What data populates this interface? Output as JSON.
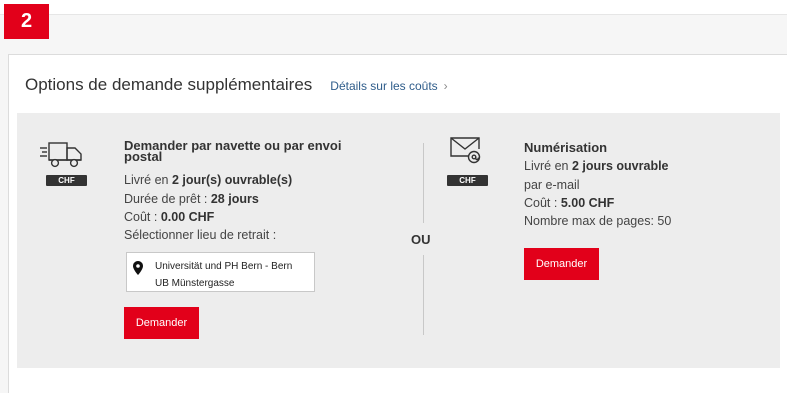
{
  "step": {
    "number": "2"
  },
  "header": {
    "title": "Options de demande supplémentaires",
    "cost_link": "Détails sur les coûts"
  },
  "separator": "OU",
  "option_shuttle": {
    "icon": "truck-icon",
    "badge": "CHF",
    "title_line1": "Demander par navette ou par envoi",
    "title_line2": "postal",
    "delivery_prefix": "Livré en ",
    "delivery_value": "2 jour(s) ouvrable(s)",
    "loan_label": "Durée de prêt : ",
    "loan_value": "28 jours",
    "cost_label": "Coût : ",
    "cost_value": "0.00  CHF",
    "pickup_label": "Sélectionner lieu de retrait :",
    "location_line1": "Universität und PH Bern - Bern",
    "location_line2": "UB Münstergasse",
    "button": "Demander"
  },
  "option_digitization": {
    "icon": "email-icon",
    "badge": "CHF",
    "title": "Numérisation",
    "delivery_prefix": "Livré en ",
    "delivery_value": "2 jours ouvrable",
    "via": "par e-mail",
    "cost_label": "Coût : ",
    "cost_value": "5.00  CHF",
    "max_pages": "Nombre max de pages: 50",
    "button": "Demander"
  },
  "colors": {
    "accent": "#e2001a",
    "link": "#2e5c8a",
    "badge": "#333333",
    "panel": "#ededed"
  }
}
